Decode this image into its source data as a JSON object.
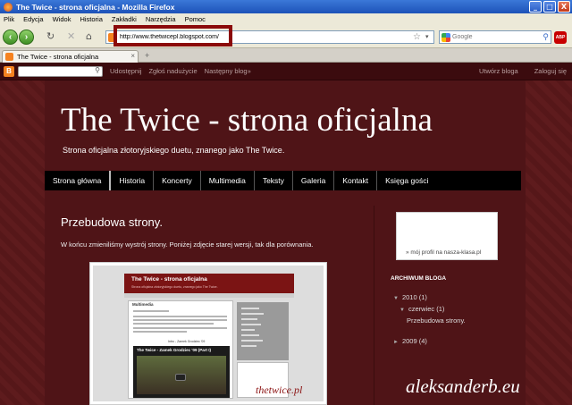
{
  "window": {
    "title": "The Twice - strona oficjalna - Mozilla Firefox",
    "buttons": [
      "_",
      "□",
      "X"
    ]
  },
  "menubar": [
    "Plik",
    "Edycja",
    "Widok",
    "Historia",
    "Zakładki",
    "Narzędzia",
    "Pomoc"
  ],
  "navbar": {
    "back_icon": "back-arrow-icon",
    "forward_icon": "forward-arrow-icon",
    "url": "http://www.thetwicepl.blogspot.com/",
    "search_placeholder": "Google"
  },
  "tab": {
    "title": "The Twice - strona oficjalna",
    "new_tab": "+"
  },
  "blogger_bar": {
    "links": [
      "Udostępnij",
      "Zgłoś nadużycie",
      "Następny blog»"
    ],
    "right_links": [
      "Utwórz bloga",
      "Zaloguj się"
    ]
  },
  "blog": {
    "title": "The Twice - strona oficjalna",
    "description": "Strona oficjalna złotoryjskiego duetu, znanego jako The Twice.",
    "tabs": [
      "Strona główna",
      "Historia",
      "Koncerty",
      "Multimedia",
      "Teksty",
      "Galeria",
      "Kontakt",
      "Księga gości"
    ]
  },
  "post": {
    "title": "Przebudowa strony.",
    "body": "W końcu zmieniliśmy wystrój strony. Poniżej zdjęcie starej wersji, tak dla porównania.",
    "screenshot": {
      "title": "The Twice - strona oficjalna",
      "subtitle": "Strona oficjalna złotoryjskiego duetu, znanego jako The Twice.",
      "section": "Multimedia",
      "caption": "Intro - Zamek Grodziec '09",
      "video_title": "The Twice - Zamek Grodziec '09 (Part I)",
      "watermark": "thetwice.pl"
    }
  },
  "sidebar": {
    "profile_link": "» mój profil na nasza-klasa.pl",
    "archive_title": "ARCHIWUM BLOGA",
    "archive": [
      {
        "year": "2010 (1)",
        "expanded": true,
        "month": "czerwiec (1)",
        "post": "Przebudowa strony."
      },
      {
        "year": "2009 (4)",
        "expanded": false
      }
    ]
  },
  "watermark": "aleksanderb.eu"
}
